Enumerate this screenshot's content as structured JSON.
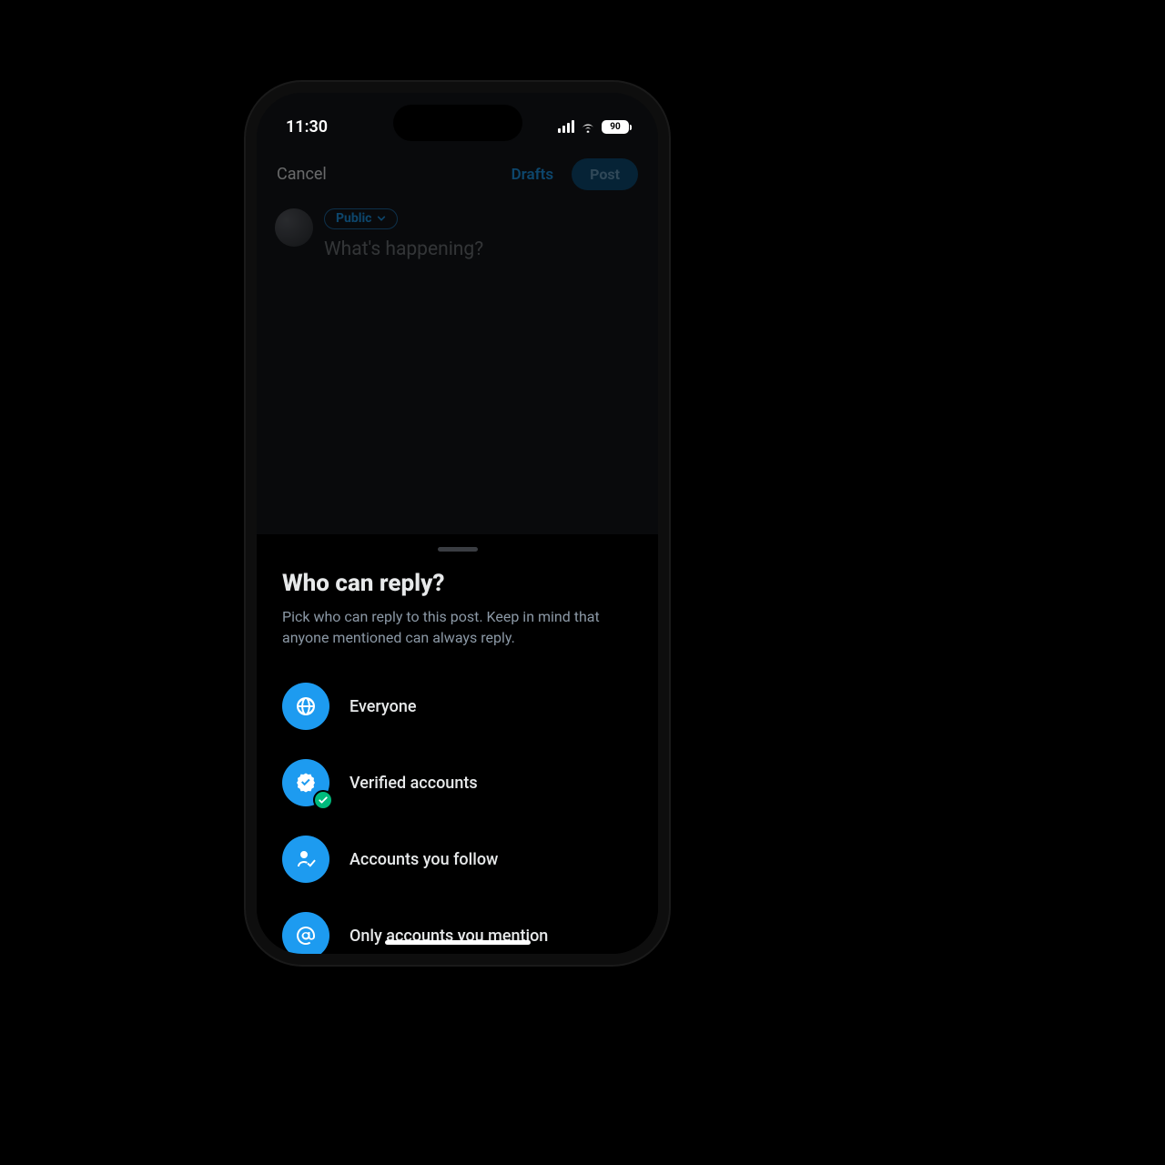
{
  "status": {
    "time": "11:30",
    "battery": "90"
  },
  "compose": {
    "cancel": "Cancel",
    "drafts": "Drafts",
    "post": "Post",
    "audience": "Public",
    "placeholder": "What's happening?"
  },
  "sheet": {
    "title": "Who can reply?",
    "subtitle": "Pick who can reply to this post. Keep in mind that anyone mentioned can always reply.",
    "options": [
      {
        "label": "Everyone",
        "icon": "globe",
        "selected": false
      },
      {
        "label": "Verified accounts",
        "icon": "verified",
        "selected": true
      },
      {
        "label": "Accounts you follow",
        "icon": "user-check",
        "selected": false
      },
      {
        "label": "Only accounts you mention",
        "icon": "at",
        "selected": false
      }
    ]
  }
}
